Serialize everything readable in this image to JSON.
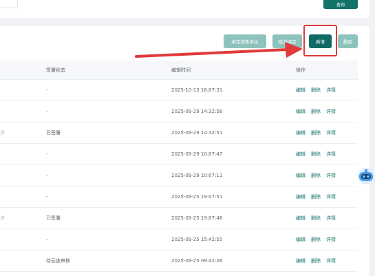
{
  "toolbar": {
    "query_label": "查询",
    "bind_sales_unit_label": "绑定销售单位",
    "unbind_label": "取消绑定",
    "add_label": "新增",
    "delete_label": "删除"
  },
  "table": {
    "headers": {
      "sign_status": "签署状态",
      "edit_time": "编辑时间",
      "actions": "操作"
    },
    "action_labels": {
      "edit": "编辑",
      "delete": "删除",
      "detail": "详情"
    },
    "rows": [
      {
        "left": "",
        "status": "-",
        "time": "2025-10-13 18:07:31"
      },
      {
        "left": "",
        "status": "-",
        "time": "2025-09-29 14:32:58"
      },
      {
        "left": "少",
        "status": "已签署",
        "time": "2025-09-29 14:32:51"
      },
      {
        "left": "",
        "status": "-",
        "time": "2025-09-29 10:07:47"
      },
      {
        "left": "",
        "status": "-",
        "time": "2025-09-29 10:07:11"
      },
      {
        "left": "",
        "status": "-",
        "time": "2025-09-25 19:07:51"
      },
      {
        "left": "少",
        "status": "已签署",
        "time": "2025-09-25 19:07:48"
      },
      {
        "left": "",
        "status": "-",
        "time": "2025-09-25 15:42:55"
      },
      {
        "left": "",
        "status": "待云途审核",
        "time": "2025-09-25 09:42:26"
      }
    ]
  },
  "colors": {
    "primary": "#13736b",
    "primary_light": "#8ec3bd",
    "highlight": "#e03a3a"
  }
}
